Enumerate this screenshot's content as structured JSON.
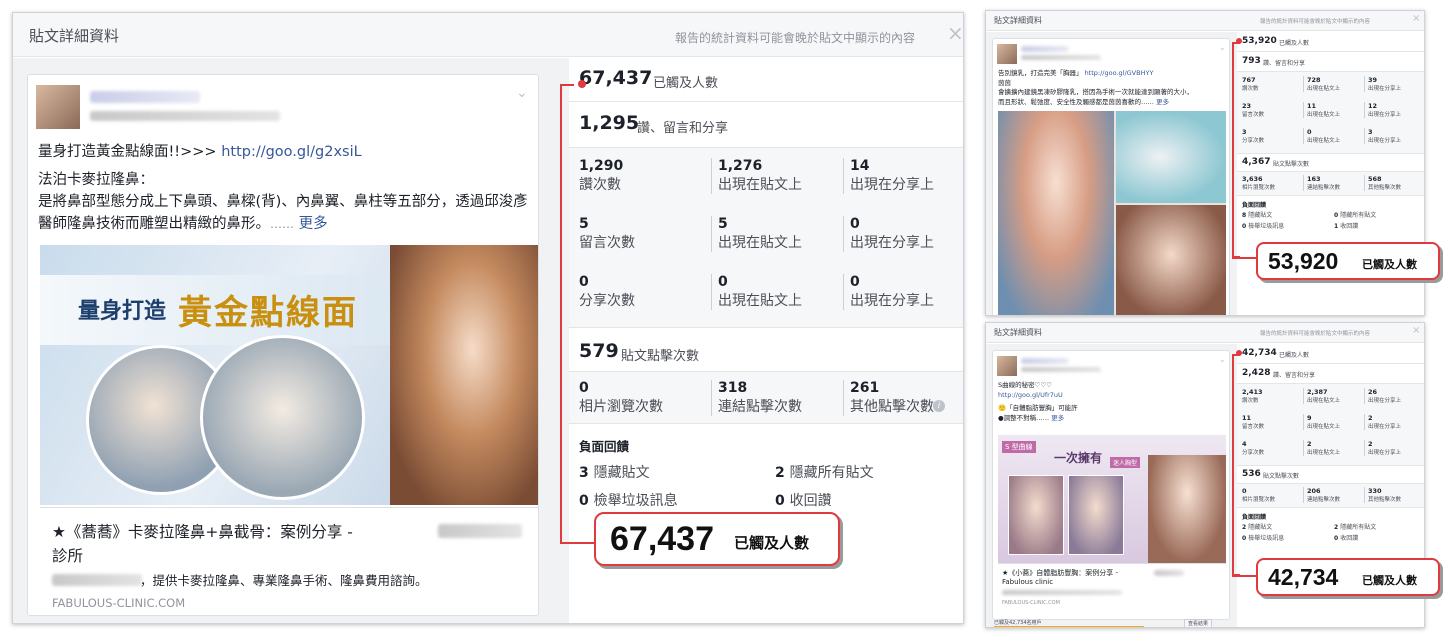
{
  "main": {
    "title": "貼文詳細資料",
    "note": "報告的統計資料可能會晚於貼文中顯示的內容",
    "close": "×",
    "post": {
      "headline": "量身打造黃金點線面!!>>> ",
      "headline_link": "http://goo.gl/g2xsiL",
      "sub": "法泊卡麥拉隆鼻：",
      "body": "是將鼻部型態分成上下鼻頭、鼻樑(背)、內鼻翼、鼻柱等五部分，透過邱浚彥醫師隆鼻技術而雕塑出精緻的鼻形。",
      "ellipsis": "……",
      "more": "更多",
      "banner_left": "量身打造",
      "banner_right": "黃金點線面",
      "link_title": "★《蕎蕎》卡麥拉隆鼻+鼻截骨：案例分享 -",
      "link_title2": "診所",
      "link_desc": "，提供卡麥拉隆鼻、專業隆鼻手術、隆鼻費用諮詢。",
      "domain": "FABULOUS-CLINIC.COM"
    },
    "reach": {
      "value": "67,437",
      "label": "已觸及人數"
    },
    "engagement": {
      "value": "1,295",
      "label": "讚、留言和分享"
    },
    "grid": [
      [
        {
          "n": "1,290",
          "l": "讚次數"
        },
        {
          "n": "1,276",
          "l": "出現在貼文上"
        },
        {
          "n": "14",
          "l": "出現在分享上"
        }
      ],
      [
        {
          "n": "5",
          "l": "留言次數"
        },
        {
          "n": "5",
          "l": "出現在貼文上"
        },
        {
          "n": "0",
          "l": "出現在分享上"
        }
      ],
      [
        {
          "n": "0",
          "l": "分享次數"
        },
        {
          "n": "0",
          "l": "出現在貼文上"
        },
        {
          "n": "0",
          "l": "出現在分享上"
        }
      ]
    ],
    "clicks": {
      "value": "579",
      "label": "貼文點擊次數"
    },
    "click_cells": [
      {
        "n": "0",
        "l": "相片瀏覽次數"
      },
      {
        "n": "318",
        "l": "連結點擊次數"
      },
      {
        "n": "261",
        "l": "其他點擊次數"
      }
    ],
    "info_icon": "i",
    "negative": {
      "title": "負面回饋",
      "items": [
        {
          "n": "3",
          "l": "隱藏貼文"
        },
        {
          "n": "2",
          "l": "隱藏所有貼文"
        },
        {
          "n": "0",
          "l": "檢舉垃圾訊息"
        },
        {
          "n": "0",
          "l": "收回讚"
        }
      ]
    },
    "callout": {
      "value": "67,437",
      "label": "已觸及人數"
    }
  },
  "top_right": {
    "title": "貼文詳細資料",
    "note": "報告的統計資料可能會晚於貼文中顯示的內容",
    "close": "×",
    "post": {
      "line1": "告別鏡乳，打造完美「胸器」",
      "link": "http://goo.gl/GVBHYY",
      "line2": "茵茵",
      "line3": "會擴擴內建鏡黑凍矽膠隆乳，搭因為手術一次就能達到顯著的大小，",
      "line4": "而且形狀、鬆弛度、安全性及觸感都是茵茵喜歡的……",
      "more": "更多"
    },
    "reach": {
      "value": "53,920",
      "label": "已觸及人數"
    },
    "engagement": {
      "value": "793",
      "label": "讚、留言和分享"
    },
    "grid": [
      [
        {
          "n": "767",
          "l": "讚次數"
        },
        {
          "n": "728",
          "l": "出現在貼文上"
        },
        {
          "n": "39",
          "l": "出現在分享上"
        }
      ],
      [
        {
          "n": "23",
          "l": "留言次數"
        },
        {
          "n": "11",
          "l": "出現在貼文上"
        },
        {
          "n": "12",
          "l": "出現在分享上"
        }
      ],
      [
        {
          "n": "3",
          "l": "分享次數"
        },
        {
          "n": "0",
          "l": "出現在貼文上"
        },
        {
          "n": "3",
          "l": "出現在分享上"
        }
      ]
    ],
    "clicks": {
      "value": "4,367",
      "label": "貼文點擊次數"
    },
    "click_cells": [
      {
        "n": "3,636",
        "l": "相片瀏覽次數"
      },
      {
        "n": "163",
        "l": "連結點擊次數"
      },
      {
        "n": "568",
        "l": "其他點擊次數"
      }
    ],
    "negative": {
      "title": "負面回饋",
      "items": [
        {
          "n": "8",
          "l": "隱藏貼文"
        },
        {
          "n": "0",
          "l": "隱藏所有貼文"
        },
        {
          "n": "0",
          "l": "檢舉垃圾訊息"
        },
        {
          "n": "1",
          "l": "收回讚"
        }
      ]
    },
    "callout": {
      "value": "53,920",
      "label": "已觸及人數"
    }
  },
  "bottom_right": {
    "title": "貼文詳細資料",
    "note": "報告的統計資料可能會晚於貼文中顯示的內容",
    "close": "×",
    "post": {
      "line1": "S曲線的秘密♡♡♡",
      "link": "http://goo.gl/Ufr7uU",
      "line2": "🙂「自體脂肪豐胸」可能許",
      "line3": "●調整不對稱……",
      "more": "更多",
      "banner1": "S 型曲線",
      "banner2": "一次擁有",
      "banner3": "迷人胸型",
      "link_title": "★《小蕎》自體脂肪豐胸：案例分享 -",
      "link_title2": "Fabulous clinic",
      "domain": "FABULOUS-CLINIC.COM",
      "reached_bar": "已觸及42,734名用戶",
      "view_button": "查看結果"
    },
    "reach": {
      "value": "42,734",
      "label": "已觸及人數"
    },
    "engagement": {
      "value": "2,428",
      "label": "讚、留言和分享"
    },
    "grid": [
      [
        {
          "n": "2,413",
          "l": "讚次數"
        },
        {
          "n": "2,387",
          "l": "出現在貼文上"
        },
        {
          "n": "26",
          "l": "出現在分享上"
        }
      ],
      [
        {
          "n": "11",
          "l": "留言次數"
        },
        {
          "n": "9",
          "l": "出現在貼文上"
        },
        {
          "n": "2",
          "l": "出現在分享上"
        }
      ],
      [
        {
          "n": "4",
          "l": "分享次數"
        },
        {
          "n": "2",
          "l": "出現在貼文上"
        },
        {
          "n": "2",
          "l": "出現在分享上"
        }
      ]
    ],
    "clicks": {
      "value": "536",
      "label": "貼文點擊次數"
    },
    "click_cells": [
      {
        "n": "0",
        "l": "相片瀏覽次數"
      },
      {
        "n": "206",
        "l": "連結點擊次數"
      },
      {
        "n": "330",
        "l": "其他點擊次數"
      }
    ],
    "negative": {
      "title": "負面回饋",
      "items": [
        {
          "n": "2",
          "l": "隱藏貼文"
        },
        {
          "n": "2",
          "l": "隱藏所有貼文"
        },
        {
          "n": "0",
          "l": "檢舉垃圾訊息"
        },
        {
          "n": "0",
          "l": "收回讚"
        }
      ]
    },
    "callout": {
      "value": "42,734",
      "label": "已觸及人數"
    }
  },
  "colors": {
    "accent_red": "#e0393e",
    "link_blue": "#365899",
    "reach_bar": "#f5a623"
  }
}
